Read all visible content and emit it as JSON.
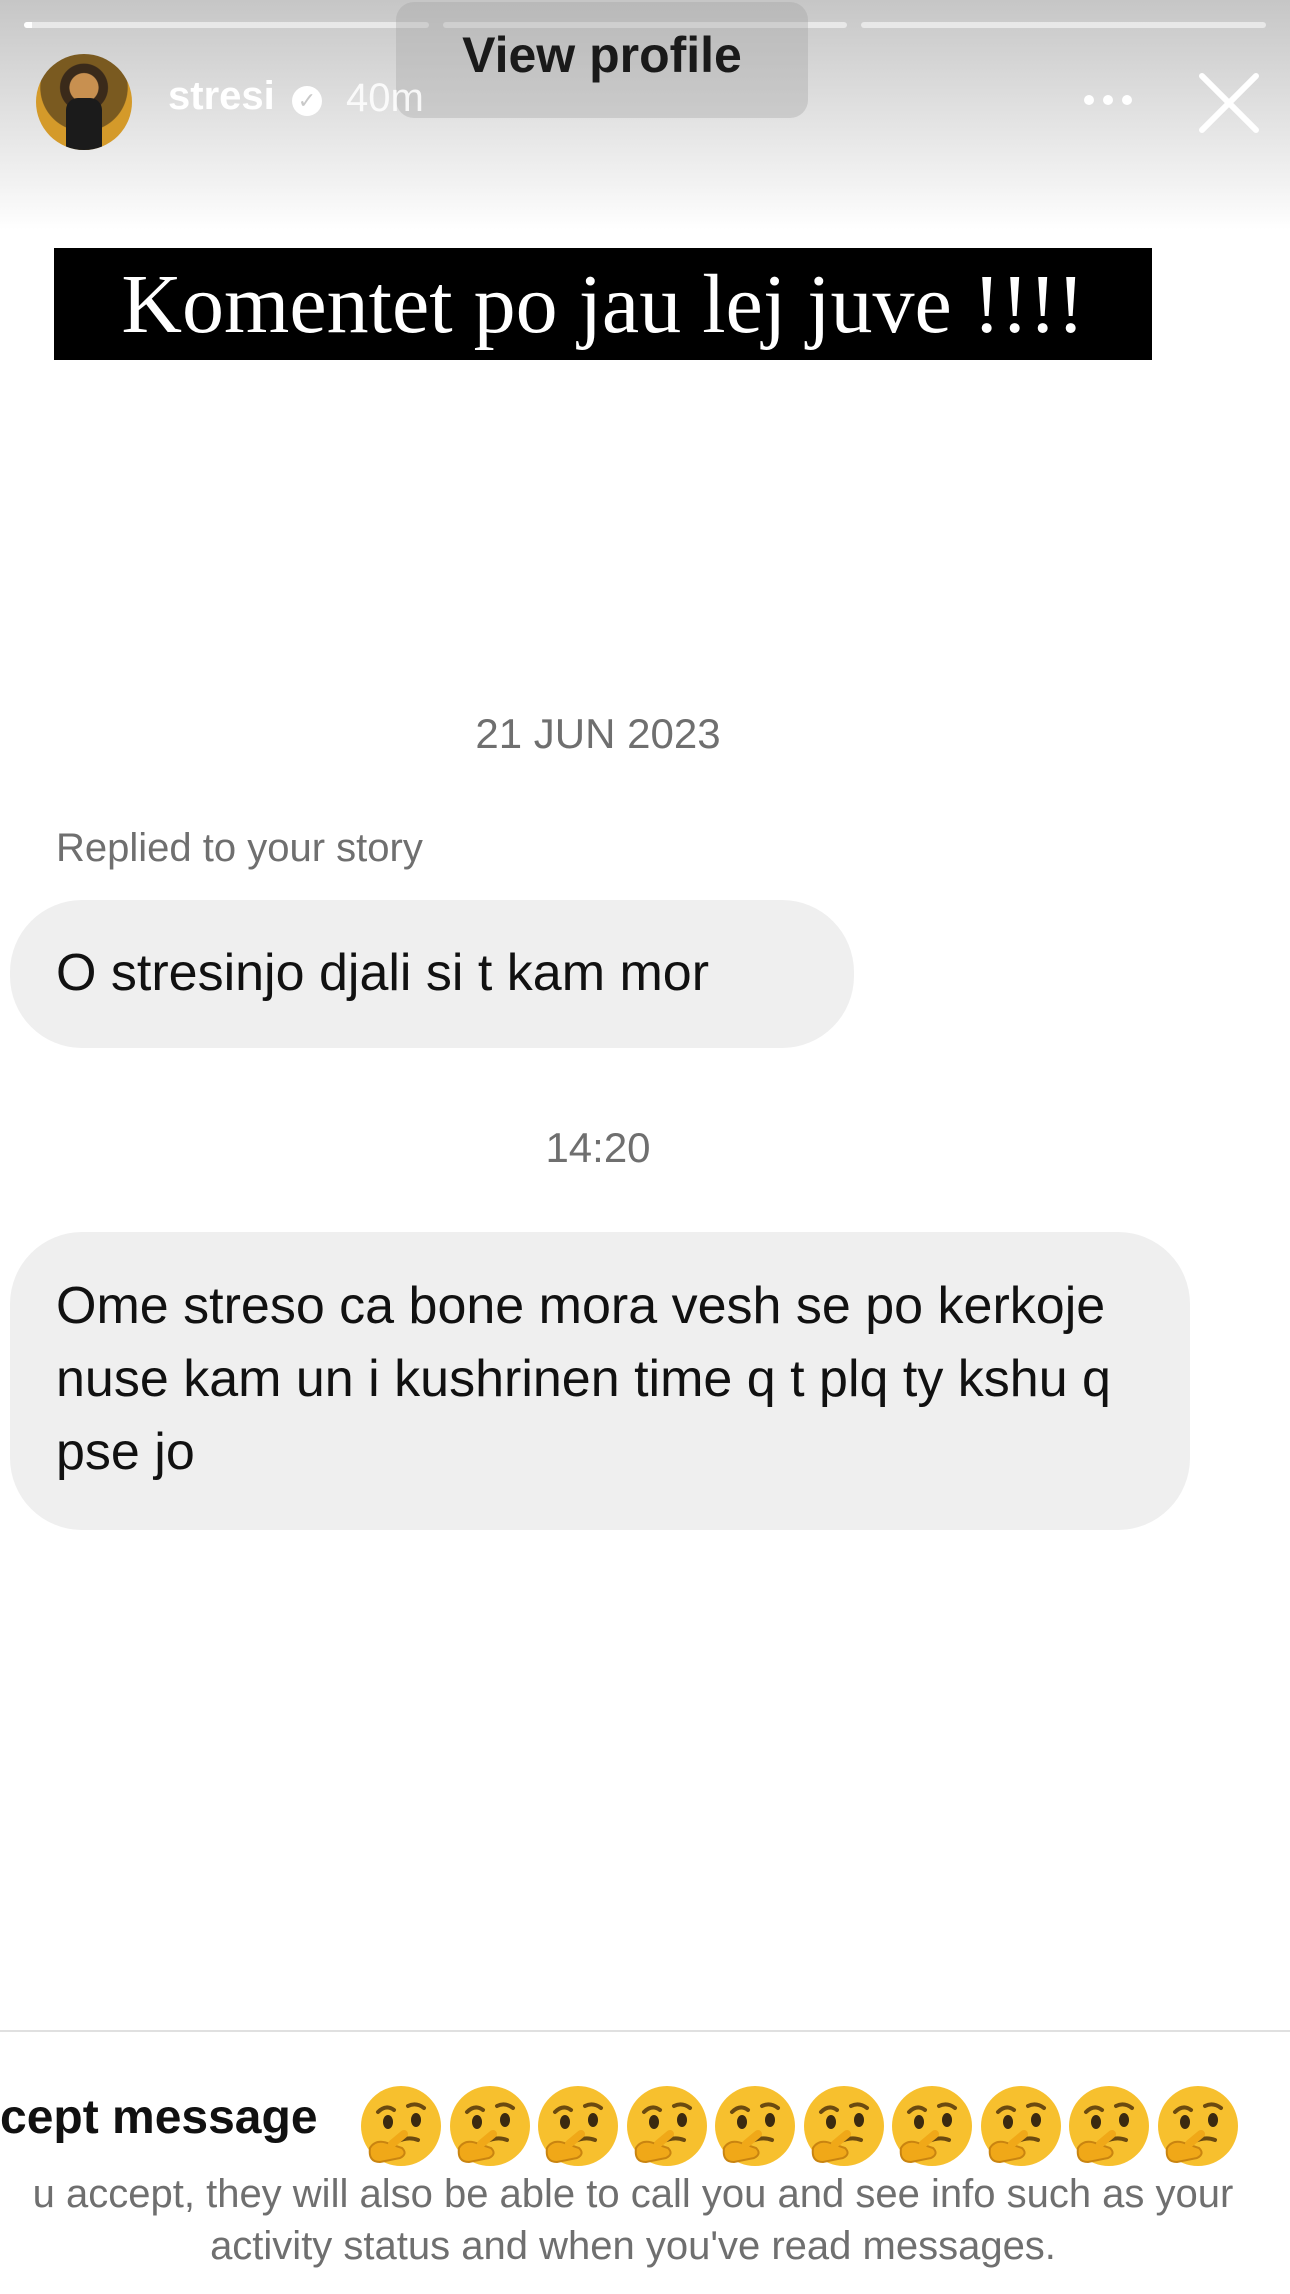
{
  "story": {
    "progress_segments": [
      0.02,
      0,
      0
    ],
    "username": "stresi",
    "time_ago": "40m",
    "view_profile_label": "View profile",
    "caption": "Komentet po jau lej juve !!!!"
  },
  "conversation": {
    "date_stamp": "21 JUN 2023",
    "replied_label": "Replied to your story",
    "message_1": "O stresinjo djali si t kam mor",
    "time_stamp": "14:20",
    "message_2": "Ome streso ca bone mora vesh se po kerkoje nuse kam un i kushrinen time q t plq ty kshu q pse jo"
  },
  "footer": {
    "accept_title": "cept message",
    "accept_body": "u accept, they will also be able to call you and see info such as your activity status and when you've read messages.",
    "emoji_name": "thinking-face-icon",
    "emoji_count": 10
  },
  "colors": {
    "caption_bg": "#000000",
    "bubble_bg": "#efefef",
    "muted_text": "#6f6f6f",
    "emoji_yellow": "#f7c02e"
  }
}
